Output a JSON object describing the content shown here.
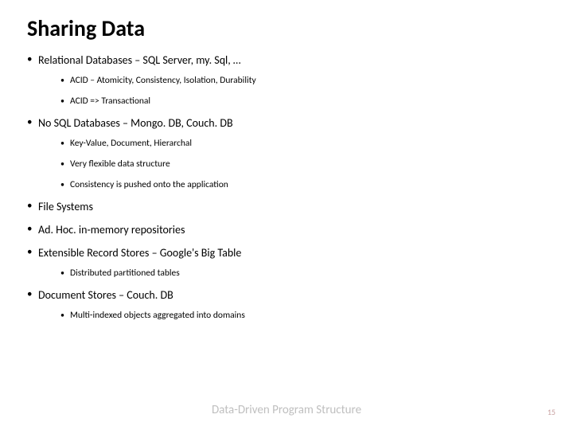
{
  "title": "Sharing Data",
  "bullets": [
    {
      "text": "Relational Databases – SQL Server, my. Sql, …",
      "children": [
        "ACID – Atomicity, Consistency, Isolation, Durability",
        "ACID => Transactional"
      ]
    },
    {
      "text": "No SQL Databases – Mongo. DB, Couch. DB",
      "children": [
        "Key-Value, Document, Hierarchal",
        "Very flexible data structure",
        "Consistency is pushed onto the application"
      ]
    },
    {
      "text": "File Systems",
      "children": []
    },
    {
      "text": "Ad. Hoc. in-memory repositories",
      "children": []
    },
    {
      "text": "Extensible Record Stores – Google's Big Table",
      "children": [
        "Distributed partitioned tables"
      ]
    },
    {
      "text": "Document Stores – Couch. DB",
      "children": [
        "Multi-indexed objects aggregated into domains"
      ]
    }
  ],
  "footer": "Data-Driven Program Structure",
  "page": "15"
}
